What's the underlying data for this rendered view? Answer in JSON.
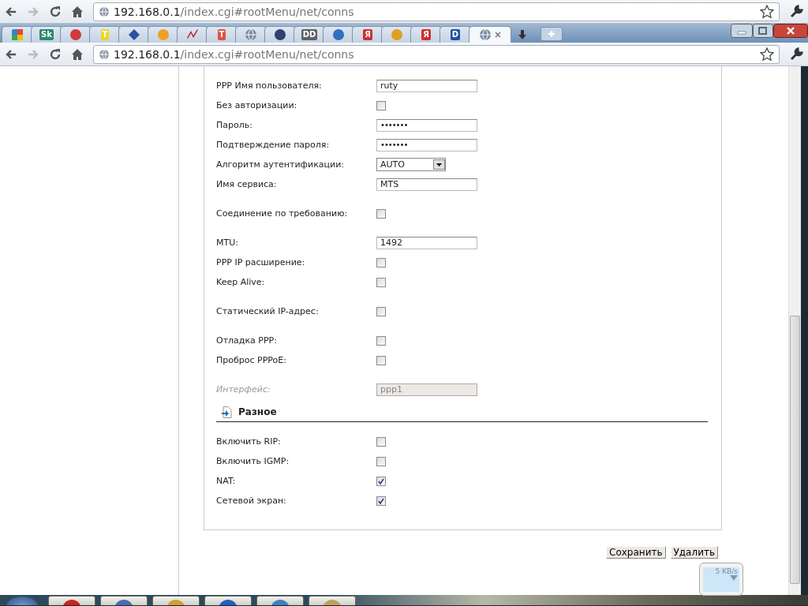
{
  "browser_bars": [
    {
      "host": "192.168.0.1",
      "path": "/index.cgi#rootMenu/net/conns"
    },
    {
      "host": "192.168.0.1",
      "path": "/index.cgi#rootMenu/net/conns"
    }
  ],
  "tabs": [
    {
      "kind": "google",
      "selected": false
    },
    {
      "kind": "letters",
      "label": "Sk",
      "color": "#2a8a6e",
      "selected": false
    },
    {
      "kind": "circle",
      "color": "#d03a3a",
      "selected": false
    },
    {
      "kind": "letters",
      "label": "T",
      "color": "#e8d820",
      "selected": false
    },
    {
      "kind": "info",
      "color": "#3050a0",
      "selected": false
    },
    {
      "kind": "circle",
      "color": "#f0a020",
      "selected": false
    },
    {
      "kind": "mark",
      "selected": false
    },
    {
      "kind": "letters",
      "label": "T",
      "color": "#e05040",
      "selected": false
    },
    {
      "kind": "globe",
      "selected": false
    },
    {
      "kind": "circle",
      "color": "#304070",
      "selected": false
    },
    {
      "kind": "letters",
      "label": "DD",
      "color": "#606060",
      "selected": false
    },
    {
      "kind": "circle",
      "color": "#3070c0",
      "selected": false
    },
    {
      "kind": "letters",
      "label": "Я",
      "color": "#d03030",
      "selected": false
    },
    {
      "kind": "circle",
      "color": "#e0a020",
      "selected": false
    },
    {
      "kind": "letters",
      "label": "Я",
      "color": "#d03030",
      "selected": false
    },
    {
      "kind": "letters",
      "label": "D",
      "color": "#2050a0",
      "selected": false
    },
    {
      "kind": "globe",
      "selected": true
    }
  ],
  "form": {
    "groups": [
      [
        {
          "label": "PPP Имя пользователя:",
          "kind": "text",
          "value": "ruty"
        },
        {
          "label": "Без авторизации:",
          "kind": "checkbox",
          "checked": false
        },
        {
          "label": "Пароль:",
          "kind": "password",
          "value": "•••••••"
        },
        {
          "label": "Подтверждение пароля:",
          "kind": "password",
          "value": "•••••••"
        },
        {
          "label": "Алгоритм аутентификации:",
          "kind": "select",
          "value": "AUTO"
        },
        {
          "label": "Имя сервиса:",
          "kind": "text",
          "value": "MTS"
        }
      ],
      [
        {
          "label": "Соединение по требованию:",
          "kind": "checkbox",
          "checked": false
        }
      ],
      [
        {
          "label": "MTU:",
          "kind": "text",
          "value": "1492"
        },
        {
          "label": "PPP IP расширение:",
          "kind": "checkbox",
          "checked": false
        },
        {
          "label": "Keep Alive:",
          "kind": "checkbox",
          "checked": false
        }
      ],
      [
        {
          "label": "Статический IP-адрес:",
          "kind": "checkbox",
          "checked": false
        }
      ],
      [
        {
          "label": "Отладка PPP:",
          "kind": "checkbox",
          "checked": false
        },
        {
          "label": "Проброс PPPoE:",
          "kind": "checkbox",
          "checked": false
        }
      ],
      [
        {
          "label": "Интерфейс:",
          "kind": "text",
          "value": "ppp1",
          "disabled": true
        }
      ]
    ],
    "section": {
      "title": "Разное",
      "rows": [
        {
          "label": "Включить RIP:",
          "kind": "checkbox",
          "checked": false
        },
        {
          "label": "Включить IGMP:",
          "kind": "checkbox",
          "checked": false
        },
        {
          "label": "NAT:",
          "kind": "checkbox",
          "checked": true
        },
        {
          "label": "Сетевой экран:",
          "kind": "checkbox",
          "checked": true
        }
      ]
    }
  },
  "buttons": [
    "Сохранить",
    "Удалить"
  ],
  "speed_widget": {
    "reading": "5 KB/s"
  }
}
